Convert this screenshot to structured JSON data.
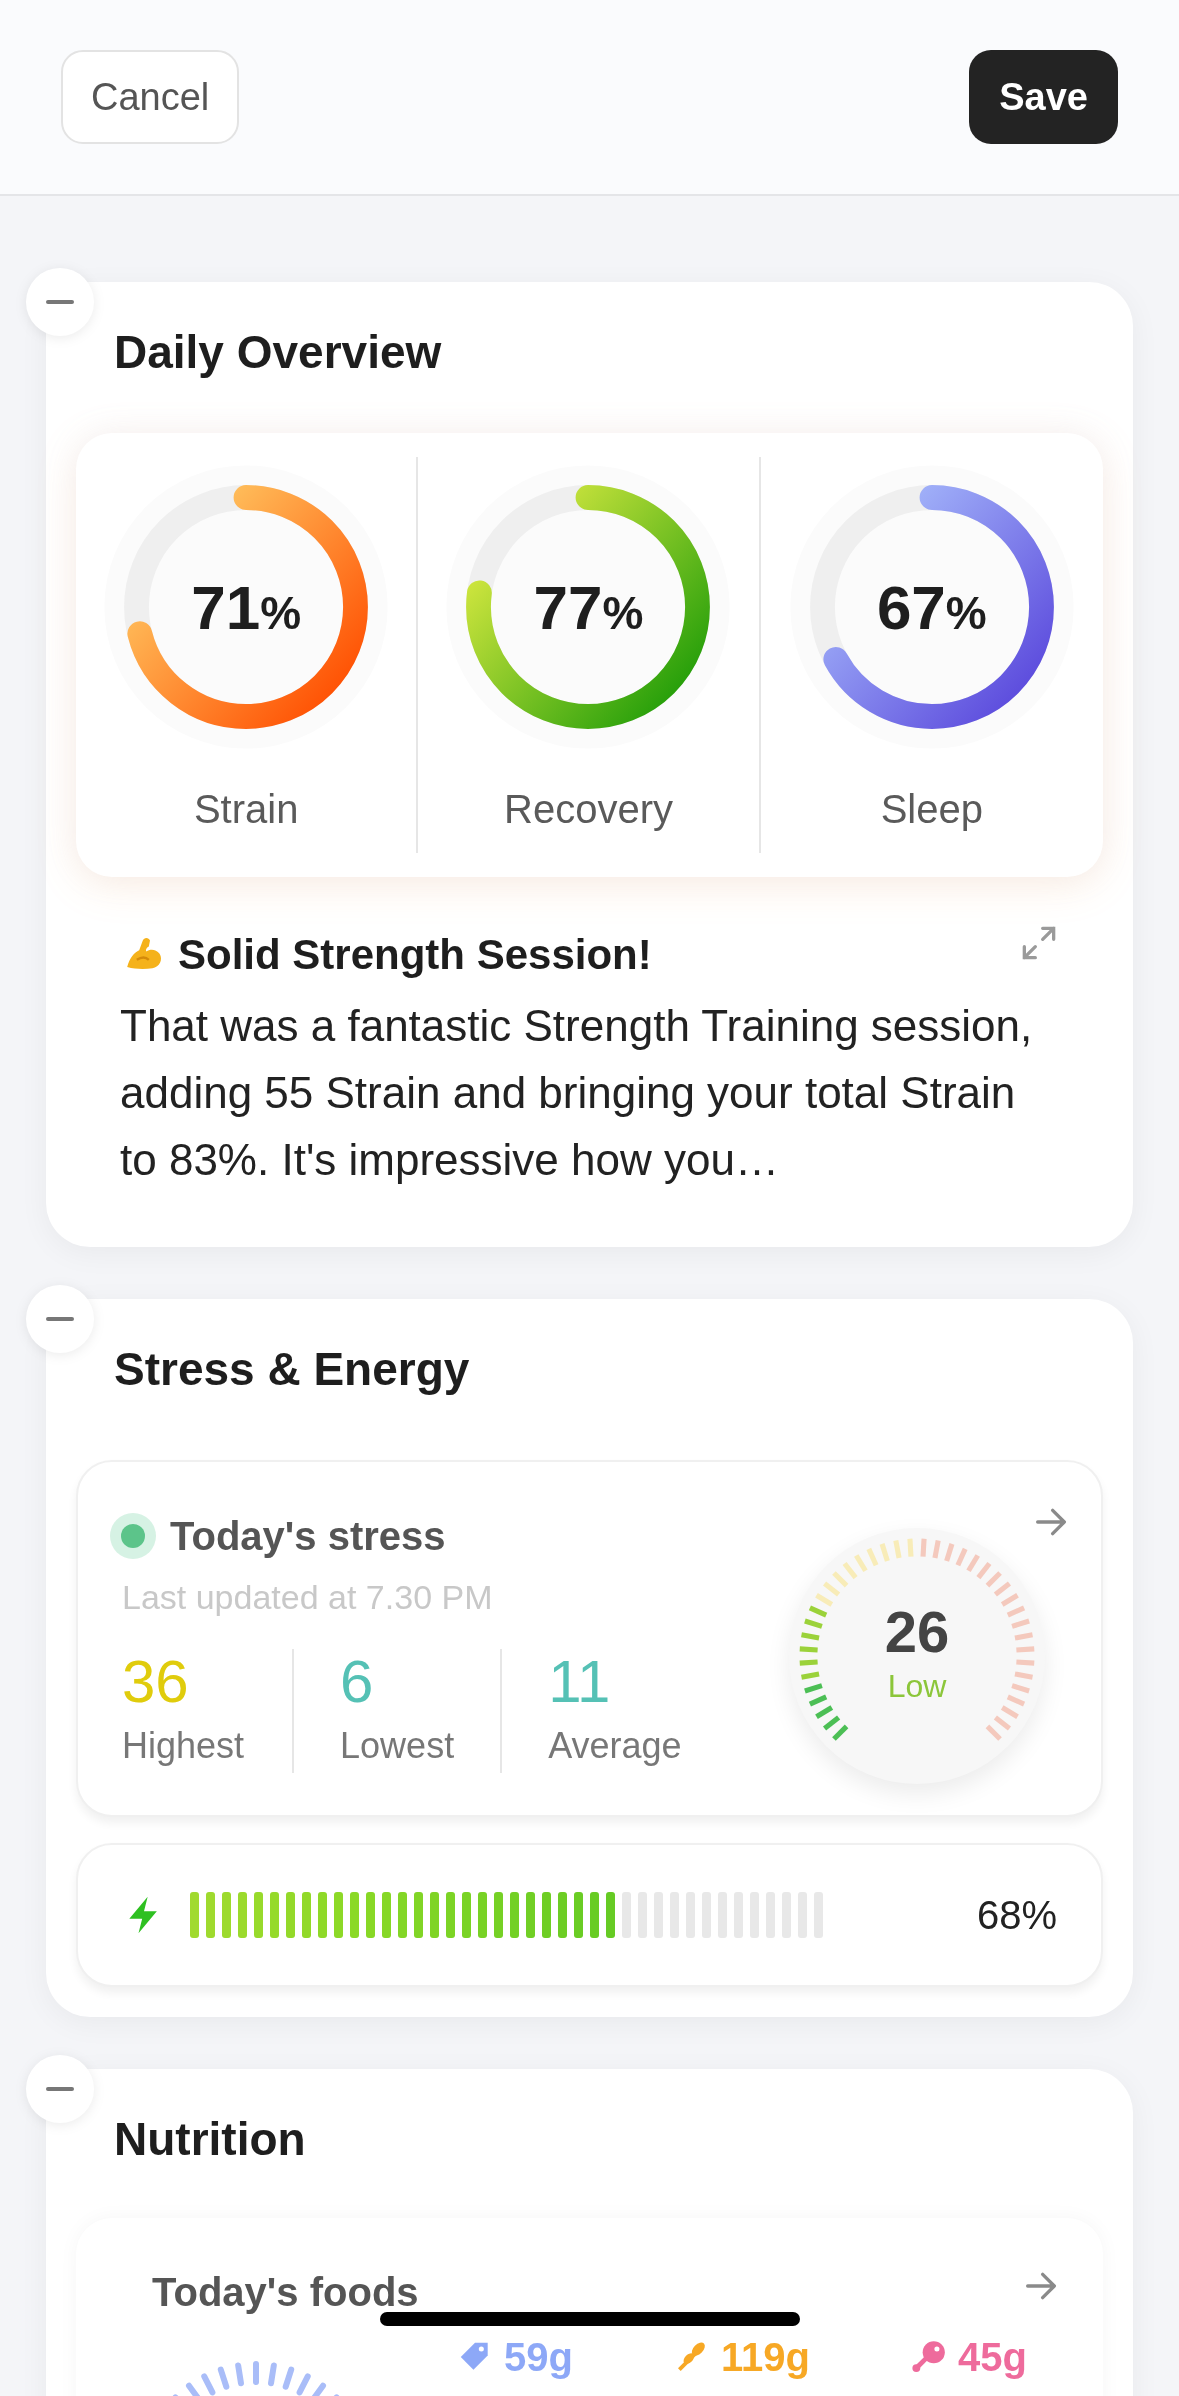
{
  "header": {
    "cancel": "Cancel",
    "save": "Save"
  },
  "daily_overview": {
    "title": "Daily Overview",
    "rings": [
      {
        "label": "Strain",
        "value": "71",
        "unit": "%",
        "level": 0.71
      },
      {
        "label": "Recovery",
        "value": "77",
        "unit": "%",
        "level": 0.77
      },
      {
        "label": "Sleep",
        "value": "67",
        "unit": "%",
        "level": 0.67
      }
    ],
    "insight": {
      "title": "Solid Strength Session!",
      "text": "That was a fantastic Strength Training session, adding 55 Strain and bringing your total Strain to 83%. It's impressive how you…"
    }
  },
  "stress_energy": {
    "title": "Stress & Energy",
    "stress": {
      "title": "Today's stress",
      "updated": "Last updated at 7.30 PM",
      "stats": [
        {
          "value": "36",
          "label": "Highest",
          "color": "#e0cc0c"
        },
        {
          "value": "6",
          "label": "Lowest",
          "color": "#55c1b5"
        },
        {
          "value": "11",
          "label": "Average",
          "color": "#55c1b5"
        }
      ],
      "gauge": {
        "value": "26",
        "label": "Low",
        "level": 0.26
      }
    },
    "energy": {
      "level": 0.68,
      "reading": "68%"
    }
  },
  "nutrition": {
    "title": "Nutrition",
    "foods_title": "Today's foods",
    "macros": [
      {
        "kind": "tag",
        "value": "59g",
        "color": "#8da8f7"
      },
      {
        "kind": "grain",
        "value": "119g",
        "color": "#f7a825"
      },
      {
        "kind": "drumstick",
        "value": "45g",
        "color": "#ee6b9c"
      }
    ]
  }
}
